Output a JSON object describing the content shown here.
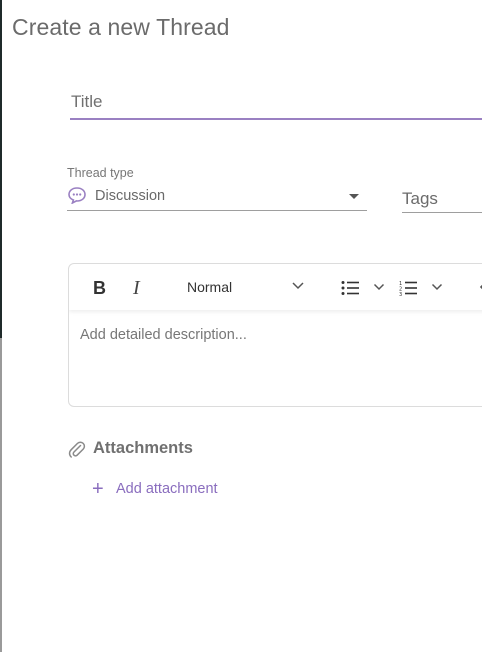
{
  "page": {
    "title": "Create a new Thread"
  },
  "title_field": {
    "placeholder": "Title",
    "value": ""
  },
  "thread_type": {
    "label": "Thread type",
    "value": "Discussion",
    "icon": "chat-bubble-icon"
  },
  "tags": {
    "label": "Tags"
  },
  "editor": {
    "toolbar": {
      "bold_label": "B",
      "italic_label": "I",
      "format_value": "Normal"
    },
    "description_placeholder": "Add detailed description..."
  },
  "attachments": {
    "heading": "Attachments",
    "add_label": "Add attachment"
  },
  "colors": {
    "accent": "#8a6dbe",
    "underline_active": "#9a80c2"
  }
}
